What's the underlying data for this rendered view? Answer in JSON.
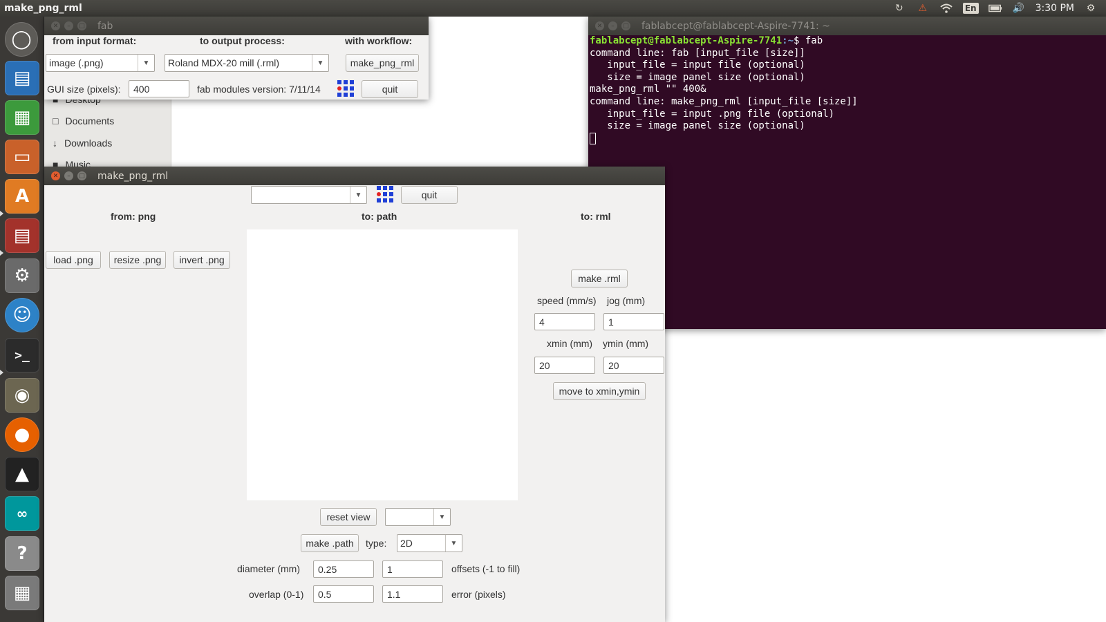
{
  "top_panel": {
    "app_title": "make_png_rml",
    "lang": "En",
    "clock": "3:30 PM"
  },
  "launcher": {
    "items": [
      "ubuntu-dash",
      "libreoffice-writer",
      "libreoffice-calc",
      "libreoffice-impress",
      "ubuntu-software-center",
      "files",
      "system-settings",
      "empathy",
      "terminal",
      "gimp",
      "firefox",
      "inkscape",
      "arduino",
      "help",
      "workspace-switcher"
    ]
  },
  "file_manager": {
    "items": [
      "Desktop",
      "Documents",
      "Downloads",
      "Music"
    ]
  },
  "fab_window": {
    "title": "fab",
    "from_label": "from input format:",
    "to_label": "to output process:",
    "workflow_label": "with workflow:",
    "input_format": "image (.png)",
    "output_process": "Roland MDX-20 mill (.rml)",
    "workflow_button": "make_png_rml",
    "gui_size_label": "GUI size (pixels):",
    "gui_size_value": "400",
    "version": "fab modules version: 7/11/14",
    "quit": "quit"
  },
  "terminal": {
    "title": "fablabcept@fablabcept-Aspire-7741: ~",
    "prompt_user": "fablabcept@fablabcept-Aspire-7741",
    "prompt_path": ":~",
    "prompt_cmd": "$ fab",
    "lines": [
      "command line: fab [input_file [size]]",
      "   input_file = input file (optional)",
      "   size = image panel size (optional)",
      "make_png_rml \"\" 400&",
      "command line: make_png_rml [input_file [size]]",
      "   input_file = input .png file (optional)",
      "   size = image panel size (optional)"
    ]
  },
  "make_window": {
    "title": "make_png_rml",
    "top_combo": "",
    "quit": "quit",
    "from_header": "from: png",
    "to_path_header": "to: path",
    "to_rml_header": "to: rml",
    "load_png": "load .png",
    "resize_png": "resize .png",
    "invert_png": "invert .png",
    "make_rml": "make .rml",
    "speed_label": "speed (mm/s)",
    "jog_label": "jog (mm)",
    "speed_value": "4",
    "jog_value": "1",
    "xmin_label": "xmin (mm)",
    "ymin_label": "ymin (mm)",
    "xmin_value": "20",
    "ymin_value": "20",
    "move_button": "move to xmin,ymin",
    "reset_view": "reset view",
    "view_combo": "",
    "make_path": "make .path",
    "type_label": "type:",
    "type_value": "2D",
    "diameter_label": "diameter (mm)",
    "diameter_value": "0.25",
    "offsets_value": "1",
    "offsets_label": "offsets (-1 to fill)",
    "overlap_label": "overlap (0-1)",
    "overlap_value": "0.5",
    "error_value": "1.1",
    "error_label": "error (pixels)"
  }
}
